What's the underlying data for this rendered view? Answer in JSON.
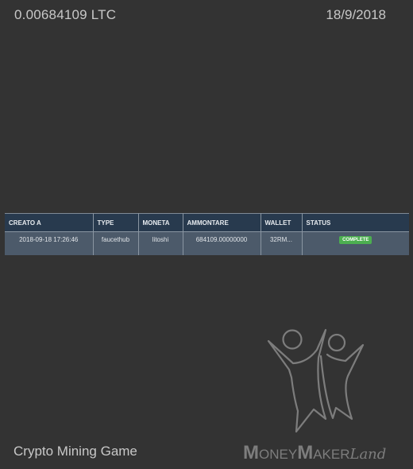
{
  "header": {
    "balance": "0.00684109 LTC",
    "date": "18/9/2018"
  },
  "table": {
    "columns": [
      "CREATO A",
      "TYPE",
      "MONETA",
      "AMMONTARE",
      "WALLET",
      "STATUS"
    ],
    "rows": [
      {
        "created_at": "2018-09-18 17:26:46",
        "type": "faucethub",
        "currency": "litoshi",
        "amount": "684109.00000000",
        "wallet": "32RM...",
        "status": "COMPLETE"
      }
    ]
  },
  "colors": {
    "background": "#333333",
    "table_header": "#283a4e",
    "table_row": "#4c5a6a",
    "status_complete": "#4caf50",
    "logo": "#7d7d7d"
  },
  "footer": {
    "title": "Crypto Mining Game",
    "logo": {
      "m1": "M",
      "oney": "ONEY",
      "m2": "M",
      "aker": "AKER",
      "land": "Land"
    }
  }
}
